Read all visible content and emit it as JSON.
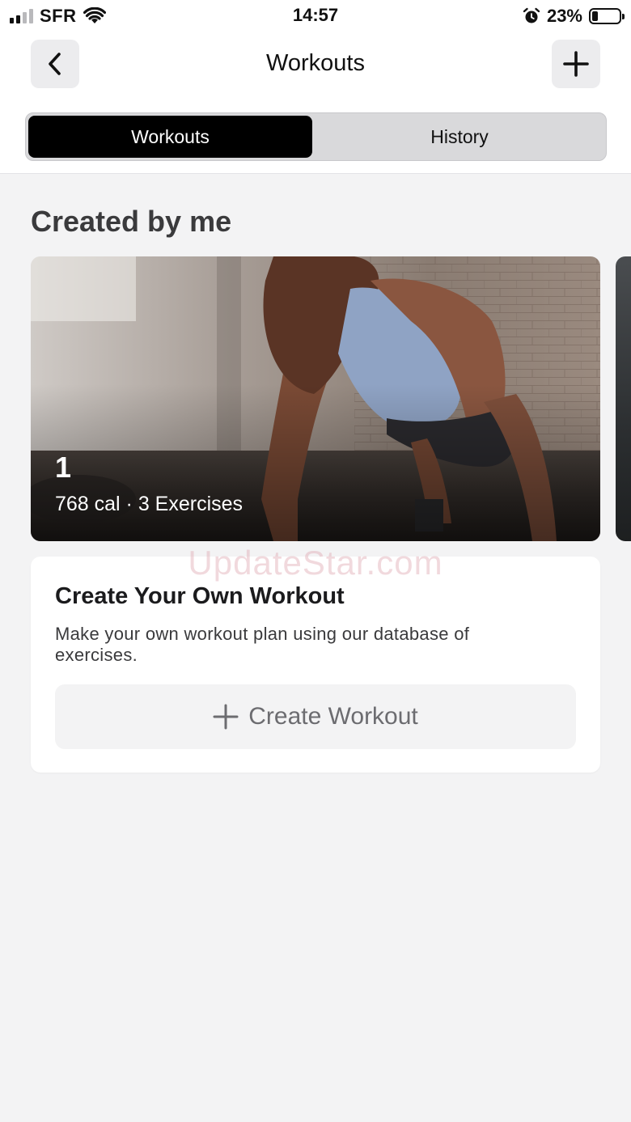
{
  "status_bar": {
    "carrier": "SFR",
    "time": "14:57",
    "battery_percent": "23%",
    "battery_level": 0.23,
    "signal_bars_active": 2,
    "signal_bars_total": 4
  },
  "header": {
    "title": "Workouts",
    "back_icon": "chevron-left-icon",
    "add_icon": "plus-icon"
  },
  "segments": {
    "active": "Workouts",
    "inactive": "History"
  },
  "section": {
    "title": "Created by me"
  },
  "workout_card": {
    "name": "1",
    "meta": "768 cal · 3 Exercises"
  },
  "create_card": {
    "title": "Create Your Own Workout",
    "description": "Make your own workout plan using our database of exercises.",
    "button_label": "Create Workout"
  },
  "watermark": "UpdateStar.com",
  "colors": {
    "accent": "#000000",
    "background": "#f3f3f4",
    "card": "#ffffff"
  }
}
